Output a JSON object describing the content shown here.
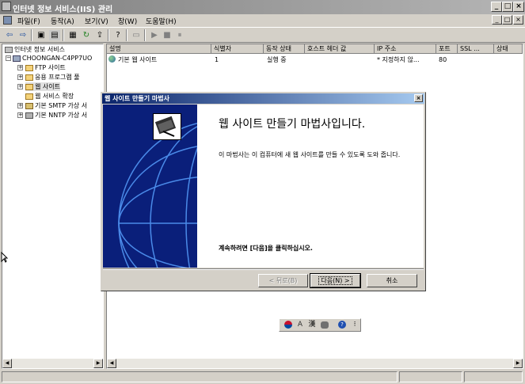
{
  "window": {
    "title": "인터넷 정보 서비스(IIS) 관리",
    "minimize": "_",
    "maximize": "□",
    "close": "×"
  },
  "menu": [
    {
      "label": "파일(F)"
    },
    {
      "label": "동작(A)"
    },
    {
      "label": "보기(V)"
    },
    {
      "label": "창(W)"
    },
    {
      "label": "도움말(H)"
    }
  ],
  "mdi_controls": {
    "minimize": "_",
    "restore": "□",
    "close": "×"
  },
  "toolbar": {
    "back": "⇦",
    "forward": "⇨",
    "up": "▣",
    "show_tree": "▤",
    "properties": "▦",
    "refresh": "↻",
    "export": "⇪",
    "help": "?",
    "computer": "▭",
    "start": "▶",
    "stop": "■",
    "pause": "⏸"
  },
  "tree": {
    "root": "인터넷 정보 서비스",
    "computer": "CHOONGAN-C4PP7UO",
    "items": [
      {
        "label": "FTP 사이트"
      },
      {
        "label": "응용 프로그램 풀"
      },
      {
        "label": "웹 사이트"
      },
      {
        "label": "웹 서비스 확장"
      },
      {
        "label": "기본 SMTP 가상 서"
      },
      {
        "label": "기본 NNTP 가상 서"
      }
    ]
  },
  "list": {
    "columns": [
      "설명",
      "식별자",
      "동작 상태",
      "호스트 헤더 값",
      "IP 주소",
      "포트",
      "SSL ...",
      "상태"
    ],
    "rows": [
      {
        "desc": "기본 웹 사이트",
        "id": "1",
        "state": "실행 중",
        "host": "",
        "ip": "* 지정하지 않...",
        "port": "80",
        "ssl": "",
        "status": ""
      }
    ]
  },
  "dialog": {
    "title": "웹 사이트 만들기 마법사",
    "close": "×",
    "heading": "웹 사이트 만들기 마법사입니다.",
    "description": "이 마법사는 이 컴퓨터에 새 웹 사이트를 만들 수 있도록 도와 줍니다.",
    "instruction": "계속하려면 [다음]을 클릭하십시오.",
    "back_button": "< 뒤로(B)",
    "next_button": "다음(N) >",
    "cancel_button": "취소"
  },
  "ime_bar": {
    "lang": "A",
    "hanja": "漢",
    "help": "?",
    "options": "⁝"
  },
  "scroll": {
    "left": "◀",
    "right": "▶"
  }
}
